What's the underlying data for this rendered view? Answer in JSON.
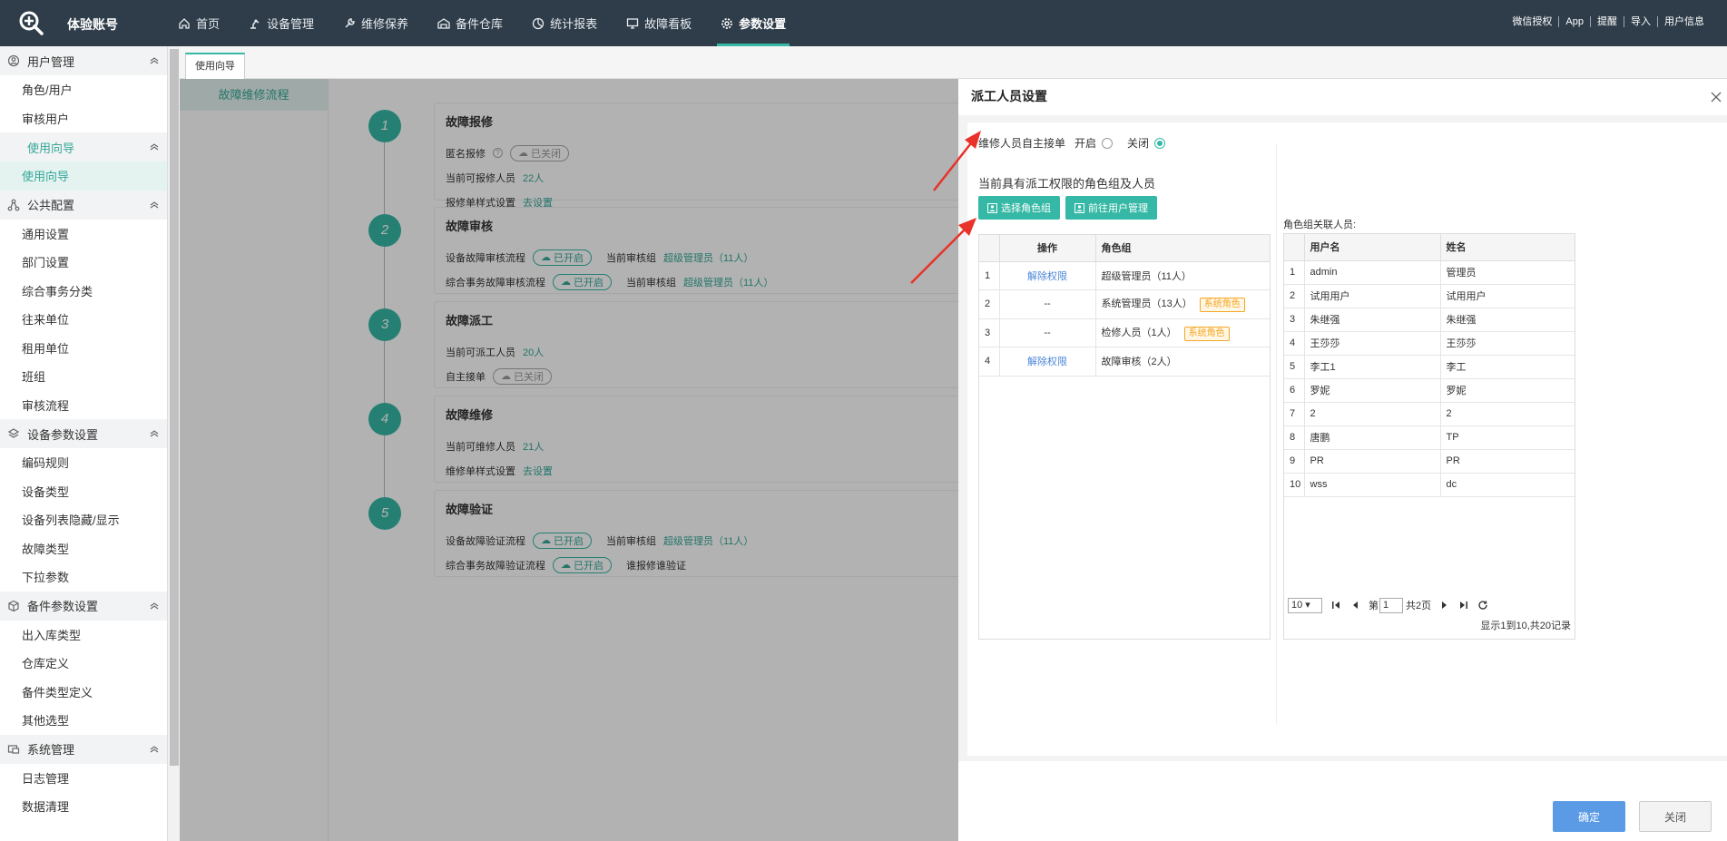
{
  "brand": "体验账号",
  "nav": [
    {
      "label": "首页",
      "icon": "home-icon"
    },
    {
      "label": "设备管理",
      "icon": "robot-arm-icon"
    },
    {
      "label": "维修保养",
      "icon": "wrench-icon"
    },
    {
      "label": "备件仓库",
      "icon": "warehouse-icon"
    },
    {
      "label": "统计报表",
      "icon": "pie-chart-icon"
    },
    {
      "label": "故障看板",
      "icon": "monitor-icon"
    },
    {
      "label": "参数设置",
      "icon": "gear-icon",
      "active": true
    }
  ],
  "top_right": [
    "微信授权",
    "App",
    "提醒",
    "导入",
    "用户信息"
  ],
  "sidebar": {
    "groups": [
      {
        "label": "用户管理",
        "icon": "user-icon",
        "items": [
          "角色/用户",
          "审核用户"
        ]
      },
      {
        "label": "使用向导",
        "icon": "",
        "items": [
          "使用向导"
        ],
        "active_item": 0
      },
      {
        "label": "公共配置",
        "icon": "network-icon",
        "items": [
          "通用设置",
          "部门设置",
          "综合事务分类",
          "往来单位",
          "租用单位",
          "班组",
          "审核流程"
        ]
      },
      {
        "label": "设备参数设置",
        "icon": "layers-icon",
        "items": [
          "编码规则",
          "设备类型",
          "设备列表隐藏/显示",
          "故障类型",
          "下拉参数"
        ]
      },
      {
        "label": "备件参数设置",
        "icon": "box-icon",
        "items": [
          "出入库类型",
          "仓库定义",
          "备件类型定义",
          "其他选型"
        ]
      },
      {
        "label": "系统管理",
        "icon": "system-icon",
        "items": [
          "日志管理",
          "数据清理"
        ]
      }
    ]
  },
  "tab": {
    "label": "使用向导"
  },
  "guide_left": {
    "item": "故障维修流程"
  },
  "steps": [
    {
      "num": "1",
      "title": "故障报修",
      "rows": [
        {
          "label": "匿名报修",
          "pill": "已关闭",
          "pill_on": false,
          "help": "?"
        },
        {
          "label": "当前可报修人员",
          "value": "22人"
        },
        {
          "label": "报修单样式设置",
          "value": "去设置"
        }
      ]
    },
    {
      "num": "2",
      "title": "故障审核",
      "rows": [
        {
          "label": "设备故障审核流程",
          "pill": "已开启",
          "pill_on": true,
          "extra_label": "当前审核组",
          "extra_value": "超级管理员（11人）"
        },
        {
          "label": "综合事务故障审核流程",
          "pill": "已开启",
          "pill_on": true,
          "extra_label": "当前审核组",
          "extra_value": "超级管理员（11人）"
        }
      ]
    },
    {
      "num": "3",
      "title": "故障派工",
      "rows": [
        {
          "label": "当前可派工人员",
          "value": "20人"
        },
        {
          "label": "自主接单",
          "pill": "已关闭",
          "pill_on": false
        }
      ]
    },
    {
      "num": "4",
      "title": "故障维修",
      "rows": [
        {
          "label": "当前可维修人员",
          "value": "21人"
        },
        {
          "label": "维修单样式设置",
          "value": "去设置"
        }
      ]
    },
    {
      "num": "5",
      "title": "故障验证",
      "rows": [
        {
          "label": "设备故障验证流程",
          "pill": "已开启",
          "pill_on": true,
          "extra_label": "当前审核组",
          "extra_value": "超级管理员（11人）"
        },
        {
          "label": "综合事务故障验证流程",
          "pill": "已开启",
          "pill_on": true,
          "extra_label": "谁报修谁验证",
          "extra_value": ""
        }
      ]
    }
  ],
  "drawer": {
    "title": "派工人员设置",
    "option_label": "维修人员自主接单",
    "option_on": "开启",
    "option_off": "关闭",
    "option_selected": "关闭",
    "section_title": "当前具有派工权限的角色组及人员",
    "btn_select_role": "选择角色组",
    "btn_user_mgmt": "前往用户管理",
    "role_table": {
      "headers": [
        "",
        "操作",
        "角色组"
      ],
      "rows": [
        {
          "idx": "1",
          "op": "解除权限",
          "role": "超级管理员（11人）",
          "tag": ""
        },
        {
          "idx": "2",
          "op": "--",
          "role": "系统管理员（13人）",
          "tag": "系统角色"
        },
        {
          "idx": "3",
          "op": "--",
          "role": "检修人员（1人）",
          "tag": "系统角色"
        },
        {
          "idx": "4",
          "op": "解除权限",
          "role": "故障审核（2人）",
          "tag": ""
        }
      ]
    },
    "right_label": "角色组关联人员:",
    "user_table": {
      "headers": [
        "",
        "用户名",
        "姓名"
      ],
      "rows": [
        {
          "idx": "1",
          "username": "admin",
          "name": "管理员"
        },
        {
          "idx": "2",
          "username": "试用用户",
          "name": "试用用户"
        },
        {
          "idx": "3",
          "username": "朱继强",
          "name": "朱继强"
        },
        {
          "idx": "4",
          "username": "王莎莎",
          "name": "王莎莎"
        },
        {
          "idx": "5",
          "username": "李工1",
          "name": "李工"
        },
        {
          "idx": "6",
          "username": "罗妮",
          "name": "罗妮"
        },
        {
          "idx": "7",
          "username": "2",
          "name": "2"
        },
        {
          "idx": "8",
          "username": "唐鹏",
          "name": "TP"
        },
        {
          "idx": "9",
          "username": "PR",
          "name": "PR"
        },
        {
          "idx": "10",
          "username": "wss",
          "name": "dc"
        }
      ]
    },
    "pager": {
      "page_size": "10",
      "page_prefix": "第",
      "page": "1",
      "total_pages": "共2页",
      "info": "显示1到10,共20记录"
    },
    "ok": "确定",
    "close": "关闭"
  }
}
